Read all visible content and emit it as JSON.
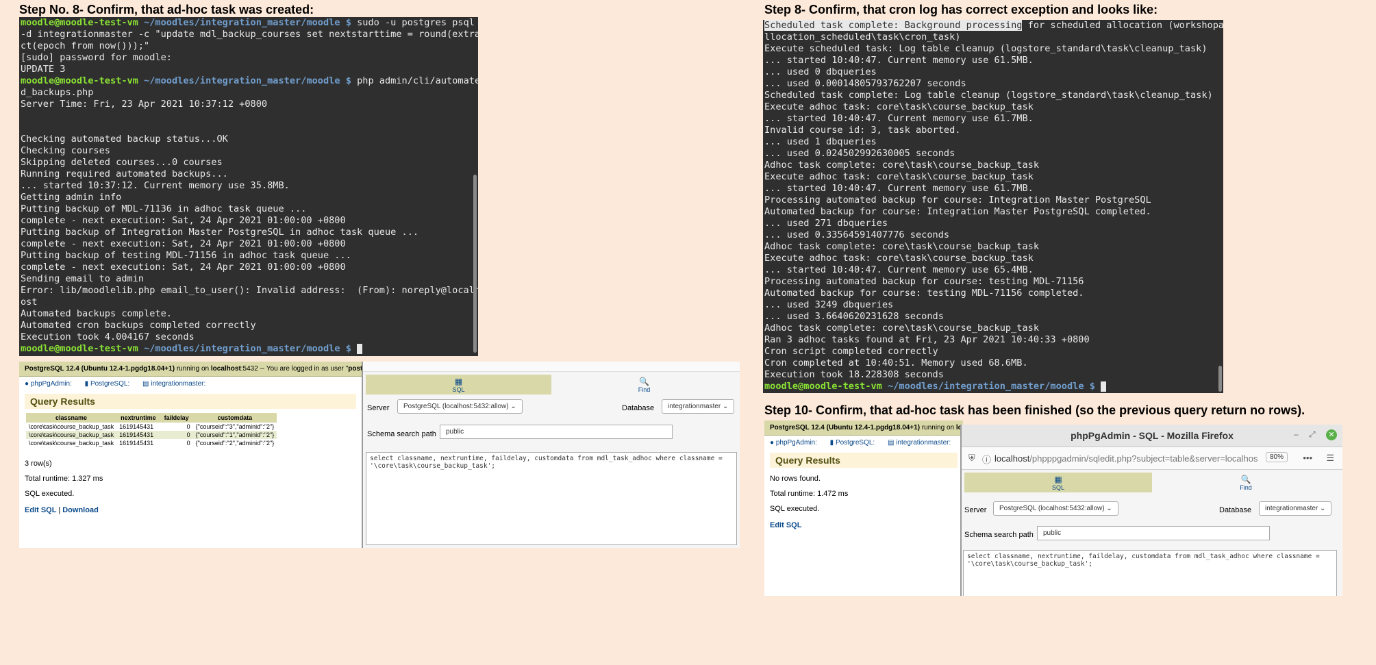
{
  "step8_title": "Step No. 8- Confirm, that ad-hoc task was created:",
  "step8b_title": "Step 8-  Confirm, that cron log has correct exception and looks like:",
  "step10_title": "Step 10-  Confirm, that ad-hoc task has been finished (so the previous query return no rows).",
  "terminal1": {
    "prompt_user": "moodle@moodle-test-vm",
    "prompt_path": "~/moodles/integration_master/moodle $",
    "lines": [
      {
        "type": "prompt",
        "cmd": " sudo -u postgres psql"
      },
      {
        "type": "out",
        "text": "-d integrationmaster -c \"update mdl_backup_courses set nextstarttime = round(extra"
      },
      {
        "type": "out",
        "text": "ct(epoch from now()));\""
      },
      {
        "type": "out",
        "text": "[sudo] password for moodle:"
      },
      {
        "type": "out",
        "text": "UPDATE 3"
      },
      {
        "type": "prompt",
        "cmd": " php admin/cli/automate"
      },
      {
        "type": "out",
        "text": "d_backups.php"
      },
      {
        "type": "out",
        "text": "Server Time: Fri, 23 Apr 2021 10:37:12 +0800"
      },
      {
        "type": "out",
        "text": ""
      },
      {
        "type": "out",
        "text": ""
      },
      {
        "type": "out",
        "text": "Checking automated backup status...OK"
      },
      {
        "type": "out",
        "text": "Checking courses"
      },
      {
        "type": "out",
        "text": "Skipping deleted courses...0 courses"
      },
      {
        "type": "out",
        "text": "Running required automated backups..."
      },
      {
        "type": "out",
        "text": "... started 10:37:12. Current memory use 35.8MB."
      },
      {
        "type": "out",
        "text": "Getting admin info"
      },
      {
        "type": "out",
        "text": "Putting backup of MDL-71136 in adhoc task queue ..."
      },
      {
        "type": "out",
        "text": "complete - next execution: Sat, 24 Apr 2021 01:00:00 +0800"
      },
      {
        "type": "out",
        "text": "Putting backup of Integration Master PostgreSQL in adhoc task queue ..."
      },
      {
        "type": "out",
        "text": "complete - next execution: Sat, 24 Apr 2021 01:00:00 +0800"
      },
      {
        "type": "out",
        "text": "Putting backup of testing MDL-71156 in adhoc task queue ..."
      },
      {
        "type": "out",
        "text": "complete - next execution: Sat, 24 Apr 2021 01:00:00 +0800"
      },
      {
        "type": "out",
        "text": "Sending email to admin"
      },
      {
        "type": "out",
        "text": "Error: lib/moodlelib.php email_to_user(): Invalid address:  (From): noreply@localh"
      },
      {
        "type": "out",
        "text": "ost"
      },
      {
        "type": "out",
        "text": "Automated backups complete."
      },
      {
        "type": "out",
        "text": "Automated cron backups completed correctly"
      },
      {
        "type": "out",
        "text": "Execution took 4.004167 seconds"
      },
      {
        "type": "prompt",
        "cmd": " "
      }
    ]
  },
  "terminal2": {
    "prompt_user": "moodle@moodle-test-vm",
    "prompt_path": "~/moodles/integration_master/moodle $",
    "highlight": "Scheduled task complete: Background processing",
    "first_rest": " for scheduled allocation (workshopa",
    "lines": [
      "llocation_scheduled\\task\\cron_task)",
      "Execute scheduled task: Log table cleanup (logstore_standard\\task\\cleanup_task)",
      "... started 10:40:47. Current memory use 61.5MB.",
      "... used 0 dbqueries",
      "... used 0.0001480579376220​7 seconds",
      "Scheduled task complete: Log table cleanup (logstore_standard\\task\\cleanup_task)",
      "Execute adhoc task: core\\task\\course_backup_task",
      "... started 10:40:47. Current memory use 61.7MB.",
      "Invalid course id: 3, task aborted.",
      "... used 1 dbqueries",
      "... used 0.024502992630005 seconds",
      "Adhoc task complete: core\\task\\course_backup_task",
      "Execute adhoc task: core\\task\\course_backup_task",
      "... started 10:40:47. Current memory use 61.7MB.",
      "Processing automated backup for course: Integration Master PostgreSQL",
      "Automated backup for course: Integration Master PostgreSQL completed.",
      "... used 271 dbqueries",
      "... used 0.33564591407776 seconds",
      "Adhoc task complete: core\\task\\course_backup_task",
      "Execute adhoc task: core\\task\\course_backup_task",
      "... started 10:40:47. Current memory use 65.4MB.",
      "Processing automated backup for course: testing MDL-71156",
      "Automated backup for course: testing MDL-71156 completed.",
      "... used 3249 dbqueries",
      "... used 3.6640620231628 seconds",
      "Adhoc task complete: core\\task\\course_backup_task",
      "Ran 3 adhoc tasks found at Fri, 23 Apr 2021 10:40:33 +0800",
      "Cron script completed correctly",
      "Cron completed at 10:40:51. Memory used 68.6MB.",
      "Execution took 18.228308 seconds"
    ]
  },
  "pga1": {
    "topbar_bold": "PostgreSQL 12.4 (Ubuntu 12.4-1.pgdg18.04+1)",
    "topbar_mid": " running on ",
    "topbar_host": "localhost",
    "topbar_rest": ":5432 -- You are logged in as user \"",
    "topbar_user": "postgres",
    "topbar_end": "\"",
    "crumbs": [
      "phpPgAdmin:",
      "PostgreSQL:",
      "integrationmaster:"
    ],
    "results_title": "Query Results",
    "columns": [
      "classname",
      "nextruntime",
      "faildelay",
      "customdata"
    ],
    "rows": [
      [
        "\\core\\task\\course_backup_task",
        "1619145431",
        "0",
        "{\"courseid\":\"3\",\"adminid\":\"2\"}"
      ],
      [
        "\\core\\task\\course_backup_task",
        "1619145431",
        "0",
        "{\"courseid\":\"1\",\"adminid\":\"2\"}"
      ],
      [
        "\\core\\task\\course_backup_task",
        "1619145431",
        "0",
        "{\"courseid\":\"2\",\"adminid\":\"2\"}"
      ]
    ],
    "rows_count": "3 row(s)",
    "runtime": "Total runtime: 1.327 ms",
    "executed": "SQL executed.",
    "edit_sql": "Edit SQL",
    "separator": "|",
    "download": "Download"
  },
  "sql1": {
    "tab_sql": "SQL",
    "tab_find": "Find",
    "server_label": "Server",
    "server_value": "PostgreSQL (localhost:5432:allow)",
    "database_label": "Database",
    "database_value": "integrationmaster",
    "schema_label": "Schema search path",
    "schema_value": "public",
    "query": "select classname, nextruntime, faildelay, customdata from mdl_task_adhoc where classname =\n'\\core\\task\\course_backup_task';"
  },
  "pga2": {
    "topbar_bold": "PostgreSQL 12.4 (Ubuntu 12.4-1.pgdg18.04+1)",
    "topbar_mid": " running on ",
    "topbar_host": "localhost",
    "crumbs": [
      "phpPgAdmin:",
      "PostgreSQL:",
      "integrationmaster:"
    ],
    "results_title": "Query Results",
    "no_rows": "No rows found.",
    "runtime": "Total runtime: 1.472 ms",
    "executed": "SQL executed.",
    "edit_sql": "Edit SQL"
  },
  "firefox": {
    "title": "phpPgAdmin - SQL - Mozilla Firefox",
    "url_host": "localhost",
    "url_path": "/phpppgadmin/sqledit.php?subject=table&server=localhos",
    "zoom": "80%",
    "tab_sql": "SQL",
    "tab_find": "Find",
    "server_label": "Server",
    "server_value": "PostgreSQL (localhost:5432:allow)",
    "database_label": "Database",
    "database_value": "integrationmaster",
    "schema_label": "Schema search path",
    "schema_value": "public",
    "query": "select classname, nextruntime, faildelay, customdata from mdl_task_adhoc where classname =\n'\\core\\task\\course_backup_task';"
  }
}
